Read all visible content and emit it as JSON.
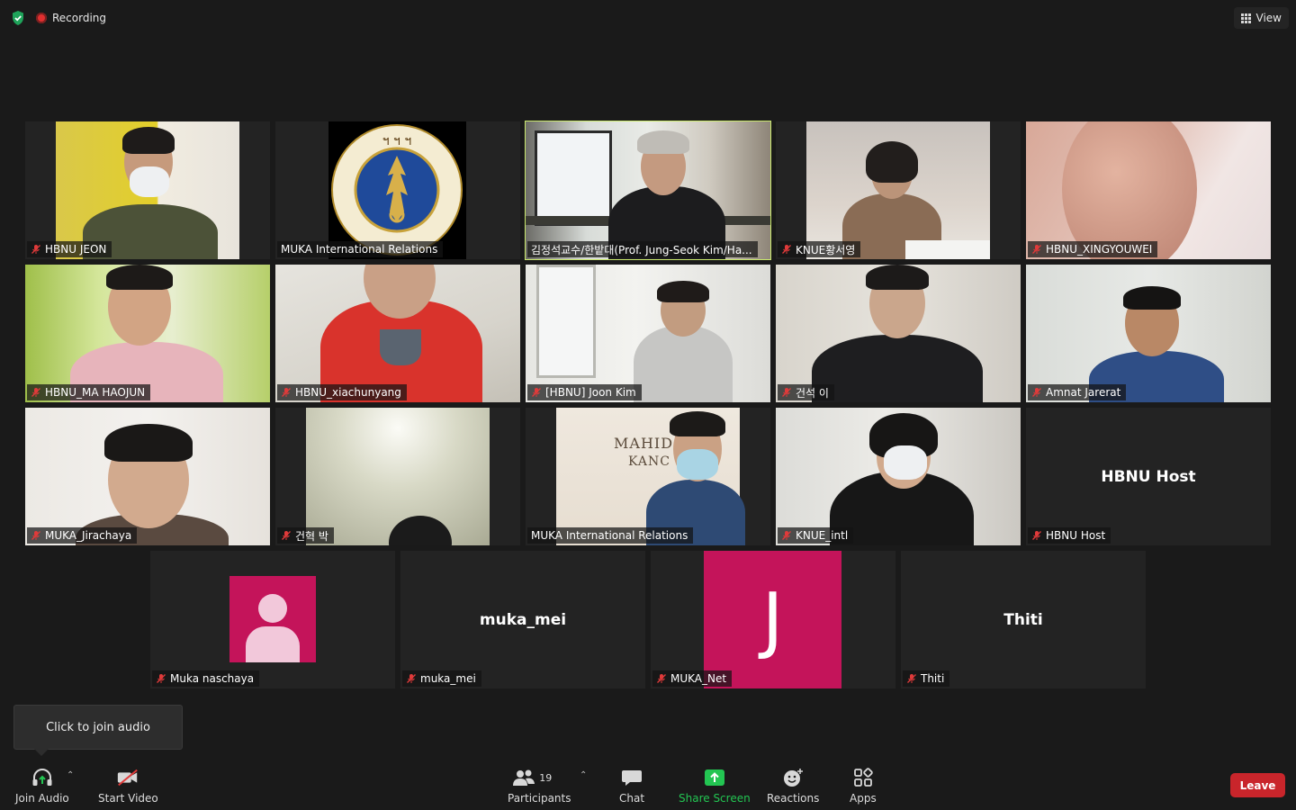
{
  "topbar": {
    "recording_label": "Recording",
    "view_label": "View"
  },
  "participants": {
    "hbnu_jeon": "HBNU JEON",
    "muka_ir_1": "MUKA International Relations",
    "prof_kim": "김정석교수/한밭대(Prof. Jung-Seok Kim/Ha...",
    "knue_hwang": "KNUE황서영",
    "hbnu_xing": "HBNU_XINGYOUWEI",
    "hbnu_ma": "HBNU_MA HAOJUN",
    "hbnu_xia": "HBNU_xiachunyang",
    "joon_kim": "[HBNU] Joon Kim",
    "geonseok": "건석 이",
    "amnat": "Amnat Jarerat",
    "muka_jira": "MUKA_Jirachaya",
    "geonhyeok": "건혁 박",
    "muka_ir_2": "MUKA International Relations",
    "knue_intl": "KNUE_intl",
    "hbnu_host": "HBNU Host",
    "muka_naschaya": "Muka naschaya",
    "muka_mei": "muka_mei",
    "muka_net": "MUKA_Net",
    "thiti": "Thiti"
  },
  "tile_center_names": {
    "hbnu_host": "HBNU Host",
    "muka_mei": "muka_mei",
    "thiti": "Thiti",
    "muka_net_initial": "J"
  },
  "tooltip": "Click to join audio",
  "toolbar": {
    "join_audio": "Join Audio",
    "start_video": "Start Video",
    "participants": "Participants",
    "participant_count": "19",
    "chat": "Chat",
    "share_screen": "Share Screen",
    "reactions": "Reactions",
    "apps": "Apps",
    "leave": "Leave"
  },
  "colors": {
    "background": "#1a1a1a",
    "tile": "#232323",
    "active_speaker_outline": "#c9e86c",
    "share_green": "#23c552",
    "leave_red": "#c9252b",
    "avatar_magenta": "#c4145a"
  },
  "logo": {
    "university_seal_text": "มหาวิทยาลัยมหิดล"
  },
  "background_text": {
    "sign_line1": "MAHID",
    "sign_line2": "KANC"
  }
}
